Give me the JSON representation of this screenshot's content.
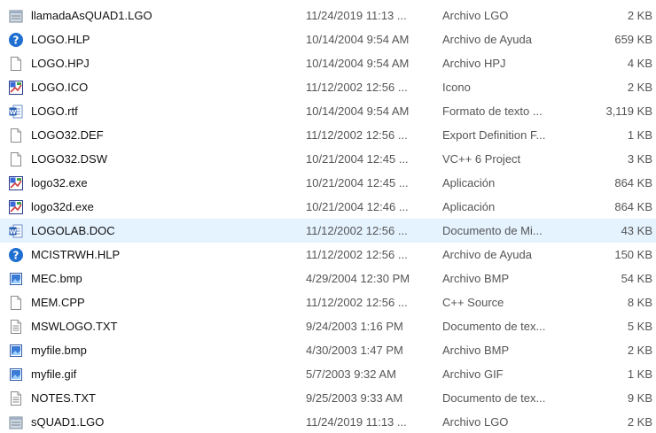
{
  "files": [
    {
      "name": "llamadaAsQUAD1.LGO",
      "date": "11/24/2019 11:13 ...",
      "type": "Archivo LGO",
      "size": "2 KB",
      "icon": "lgo-file-icon"
    },
    {
      "name": "LOGO.HLP",
      "date": "10/14/2004 9:54 AM",
      "type": "Archivo de Ayuda",
      "size": "659 KB",
      "icon": "help-file-icon"
    },
    {
      "name": "LOGO.HPJ",
      "date": "10/14/2004 9:54 AM",
      "type": "Archivo HPJ",
      "size": "4 KB",
      "icon": "blank-file-icon"
    },
    {
      "name": "LOGO.ICO",
      "date": "11/12/2002 12:56 ...",
      "type": "Icono",
      "size": "2 KB",
      "icon": "icon-file-icon"
    },
    {
      "name": "LOGO.rtf",
      "date": "10/14/2004 9:54 AM",
      "type": "Formato de texto ...",
      "size": "3,119 KB",
      "icon": "word-file-icon"
    },
    {
      "name": "LOGO32.DEF",
      "date": "11/12/2002 12:56 ...",
      "type": "Export Definition F...",
      "size": "1 KB",
      "icon": "blank-file-icon"
    },
    {
      "name": "LOGO32.DSW",
      "date": "10/21/2004 12:45 ...",
      "type": "VC++ 6 Project",
      "size": "3 KB",
      "icon": "blank-file-icon"
    },
    {
      "name": "logo32.exe",
      "date": "10/21/2004 12:45 ...",
      "type": "Aplicación",
      "size": "864 KB",
      "icon": "exe-file-icon"
    },
    {
      "name": "logo32d.exe",
      "date": "10/21/2004 12:46 ...",
      "type": "Aplicación",
      "size": "864 KB",
      "icon": "exe-file-icon"
    },
    {
      "name": "LOGOLAB.DOC",
      "date": "11/12/2002 12:56 ...",
      "type": "Documento de Mi...",
      "size": "43 KB",
      "icon": "word-file-icon",
      "hover": true
    },
    {
      "name": "MCISTRWH.HLP",
      "date": "11/12/2002 12:56 ...",
      "type": "Archivo de Ayuda",
      "size": "150 KB",
      "icon": "help-file-icon"
    },
    {
      "name": "MEC.bmp",
      "date": "4/29/2004 12:30 PM",
      "type": "Archivo BMP",
      "size": "54 KB",
      "icon": "image-file-icon"
    },
    {
      "name": "MEM.CPP",
      "date": "11/12/2002 12:56 ...",
      "type": "C++ Source",
      "size": "8 KB",
      "icon": "blank-file-icon"
    },
    {
      "name": "MSWLOGO.TXT",
      "date": "9/24/2003 1:16 PM",
      "type": "Documento de tex...",
      "size": "5 KB",
      "icon": "text-file-icon"
    },
    {
      "name": "myfile.bmp",
      "date": "4/30/2003 1:47 PM",
      "type": "Archivo BMP",
      "size": "2 KB",
      "icon": "image-file-icon"
    },
    {
      "name": "myfile.gif",
      "date": "5/7/2003 9:32 AM",
      "type": "Archivo GIF",
      "size": "1 KB",
      "icon": "image-file-icon"
    },
    {
      "name": "NOTES.TXT",
      "date": "9/25/2003 9:33 AM",
      "type": "Documento de tex...",
      "size": "9 KB",
      "icon": "text-file-icon"
    },
    {
      "name": "sQUAD1.LGO",
      "date": "11/24/2019 11:13 ...",
      "type": "Archivo LGO",
      "size": "2 KB",
      "icon": "lgo-file-icon"
    }
  ]
}
